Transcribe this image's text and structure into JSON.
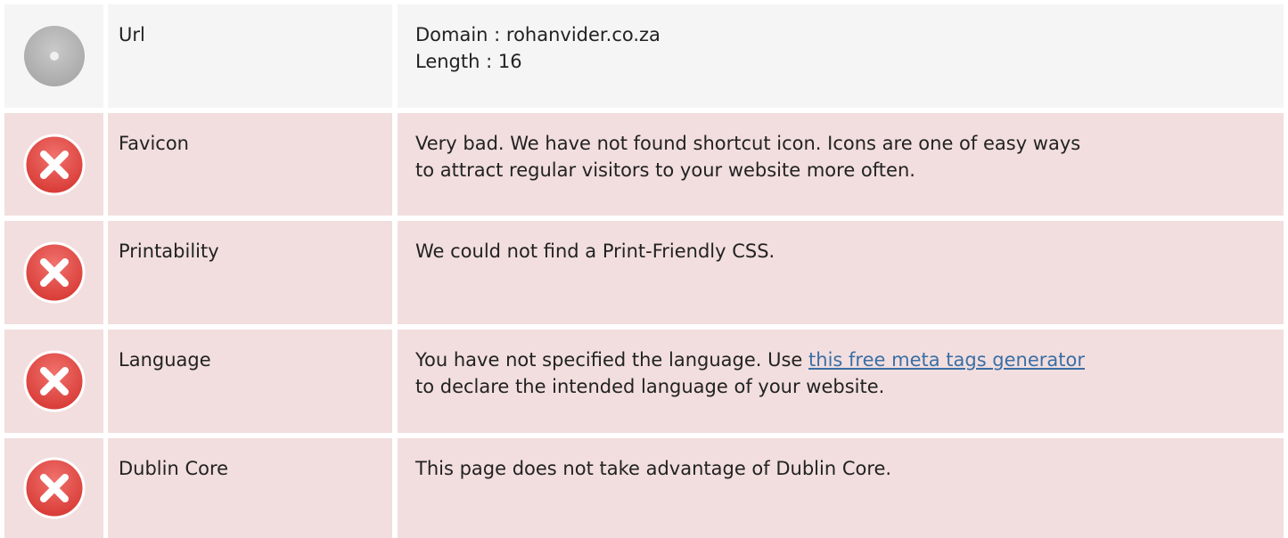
{
  "rows": [
    {
      "status": "neutral",
      "icon": "info-disc-icon",
      "label": "Url",
      "lines": [
        "Domain : rohanvider.co.za",
        "Length : 16"
      ]
    },
    {
      "status": "error",
      "icon": "error-x-icon",
      "label": "Favicon",
      "lines": [
        "Very bad. We have not found shortcut icon. Icons are one of easy ways",
        "to attract regular visitors to your website more often."
      ]
    },
    {
      "status": "error",
      "icon": "error-x-icon",
      "label": "Printability",
      "lines": [
        "We could not find a Print-Friendly CSS."
      ]
    },
    {
      "status": "error",
      "icon": "error-x-icon",
      "label": "Language",
      "text_before_link": "You have not specified the language. Use ",
      "link_text": "this free meta tags generator",
      "line2": "to declare the intended language of your website."
    },
    {
      "status": "error",
      "icon": "error-x-icon",
      "label": "Dublin Core",
      "lines": [
        "This page does not take advantage of Dublin Core."
      ]
    }
  ],
  "colors": {
    "neutral_bg": "#f5f5f5",
    "error_bg": "#f2dede",
    "error_icon": "#e0443e",
    "neutral_icon": "#b5b5b5",
    "link": "#3a6ea5"
  }
}
